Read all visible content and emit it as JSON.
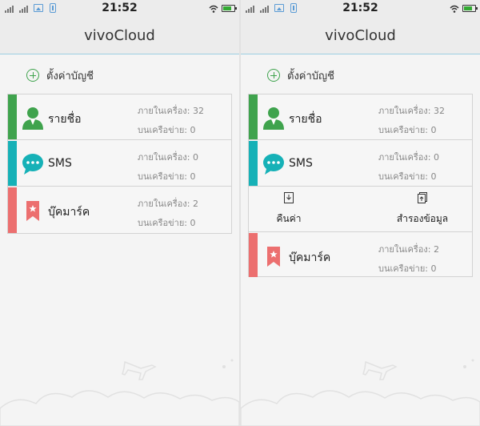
{
  "status": {
    "time": "21:52"
  },
  "app": {
    "title": "vivoCloud"
  },
  "settings": {
    "label": "ตั้งค่าบัญชี"
  },
  "items": {
    "contacts": {
      "name": "รายชื่อ",
      "local": "ภายในเครื่อง: 32",
      "network": "บนเครือข่าย: 0"
    },
    "sms": {
      "name": "SMS",
      "local": "ภายในเครื่อง: 0",
      "network": "บนเครือข่าย: 0"
    },
    "bookmarks": {
      "name": "บุ๊คมาร์ค",
      "local": "ภายในเครื่อง: 2",
      "network": "บนเครือข่าย: 0"
    }
  },
  "actions": {
    "restore": "คืนค่า",
    "backup": "สำรองข้อมูล"
  },
  "colors": {
    "contacts": "#3fa34d",
    "sms": "#16b1b7",
    "bookmarks": "#ec6f6f",
    "title_underline": "#9ccfe2"
  }
}
